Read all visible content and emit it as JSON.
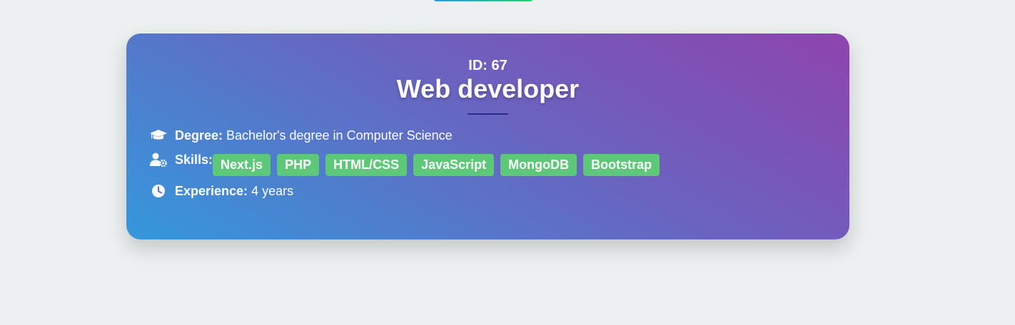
{
  "job": {
    "id_text": "ID: 67",
    "title": "Web developer"
  },
  "details": {
    "degree": {
      "icon": "graduation-cap-icon",
      "label": "Degree:",
      "value": "Bachelor's degree in Computer Science"
    },
    "skills": {
      "icon": "user-gear-icon",
      "label": "Skills:",
      "tags": [
        "Next.js",
        "PHP",
        "HTML/CSS",
        "JavaScript",
        "MongoDB",
        "Bootstrap"
      ]
    },
    "experience": {
      "icon": "clock-icon",
      "label": "Experience:",
      "value": "4 years"
    }
  },
  "colors": {
    "background": "#ecf0f1",
    "card_gradient_start": "#8e44ad",
    "card_gradient_end": "#3498db",
    "tag_bg": "#5ec879",
    "divider": "#2c2c8c"
  }
}
